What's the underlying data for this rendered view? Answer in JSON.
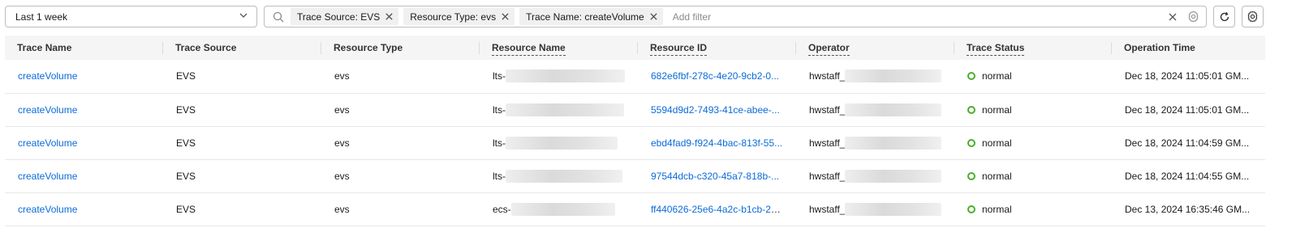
{
  "time_filter": {
    "value": "Last 1 week"
  },
  "search": {
    "tags": [
      {
        "label": "Trace Source: EVS"
      },
      {
        "label": "Resource Type: evs"
      },
      {
        "label": "Trace Name: createVolume"
      }
    ],
    "placeholder": "Add filter"
  },
  "table": {
    "columns": [
      {
        "label": "Trace Name",
        "dashed": false
      },
      {
        "label": "Trace Source",
        "dashed": false
      },
      {
        "label": "Resource Type",
        "dashed": false
      },
      {
        "label": "Resource Name",
        "dashed": true
      },
      {
        "label": "Resource ID",
        "dashed": true
      },
      {
        "label": "Operator",
        "dashed": true
      },
      {
        "label": "Trace Status",
        "dashed": true
      },
      {
        "label": "Operation Time",
        "dashed": false
      }
    ],
    "rows": [
      {
        "trace_name": "createVolume",
        "trace_source": "EVS",
        "resource_type": "evs",
        "resource_name_prefix": "lts-",
        "resource_id": "682e6fbf-278c-4e20-9cb2-0...",
        "operator_prefix": "hwstaff_",
        "status": "normal",
        "operation_time": "Dec 18, 2024 11:05:01 GM..."
      },
      {
        "trace_name": "createVolume",
        "trace_source": "EVS",
        "resource_type": "evs",
        "resource_name_prefix": "lts-",
        "resource_id": "5594d9d2-7493-41ce-abee-...",
        "operator_prefix": "hwstaff_",
        "status": "normal",
        "operation_time": "Dec 18, 2024 11:05:01 GM..."
      },
      {
        "trace_name": "createVolume",
        "trace_source": "EVS",
        "resource_type": "evs",
        "resource_name_prefix": "lts-",
        "resource_id": "ebd4fad9-f924-4bac-813f-55...",
        "operator_prefix": "hwstaff_",
        "status": "normal",
        "operation_time": "Dec 18, 2024 11:04:59 GM..."
      },
      {
        "trace_name": "createVolume",
        "trace_source": "EVS",
        "resource_type": "evs",
        "resource_name_prefix": "lts-",
        "resource_id": "97544dcb-c320-45a7-818b-...",
        "operator_prefix": "hwstaff_",
        "status": "normal",
        "operation_time": "Dec 18, 2024 11:04:55 GM..."
      },
      {
        "trace_name": "createVolume",
        "trace_source": "EVS",
        "resource_type": "evs",
        "resource_name_prefix": "ecs-",
        "resource_id": "ff440626-25e6-4a2c-b1cb-2c...",
        "operator_prefix": "hwstaff_",
        "status": "normal",
        "operation_time": "Dec 13, 2024 16:35:46 GM..."
      }
    ]
  },
  "colors": {
    "link": "#0b6bd9",
    "status_normal": "#4cae2d",
    "header_bg": "#f5f5f5",
    "border": "#bdbdbd"
  },
  "icons": [
    "chevron-down-icon",
    "search-icon",
    "close-icon",
    "clear-icon",
    "settings-icon",
    "refresh-icon"
  ]
}
